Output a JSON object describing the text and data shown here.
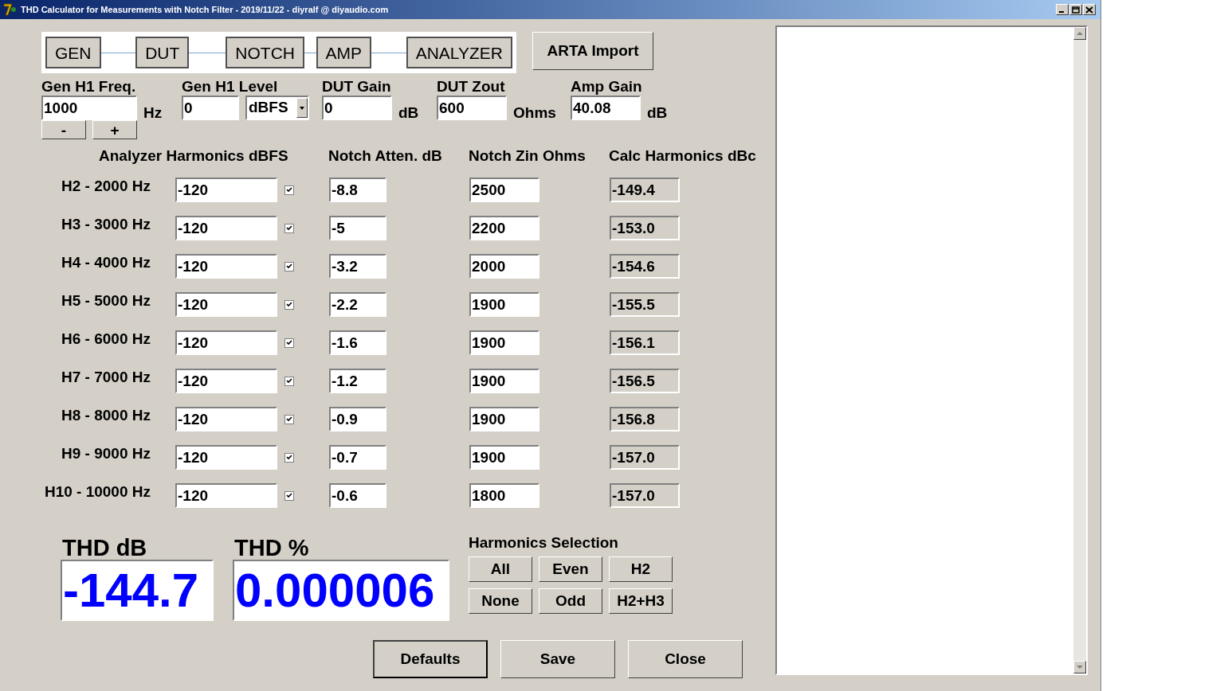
{
  "window": {
    "title": "THD Calculator for Measurements with Notch Filter - 2019/11/22 - diyralf @ diyaudio.com"
  },
  "chain": [
    "GEN",
    "DUT",
    "NOTCH",
    "AMP",
    "ANALYZER"
  ],
  "arta_button": "ARTA Import",
  "params": {
    "gen_freq": {
      "label": "Gen H1 Freq.",
      "value": "1000",
      "unit": "Hz"
    },
    "step_buttons": [
      "-",
      "+"
    ],
    "gen_level": {
      "label": "Gen H1 Level",
      "value": "0",
      "unit": "dBFS"
    },
    "dut_gain": {
      "label": "DUT Gain",
      "value": "0",
      "unit": "dB"
    },
    "dut_zout": {
      "label": "DUT Zout",
      "value": "600",
      "unit": "Ohms"
    },
    "amp_gain": {
      "label": "Amp Gain",
      "value": "40.08",
      "unit": "dB"
    }
  },
  "table": {
    "columns": [
      "Analyzer Harmonics dBFS",
      "Notch Atten. dB",
      "Notch Zin Ohms",
      "Calc Harmonics dBc"
    ],
    "rows": [
      {
        "label": "H2 - 2000 Hz",
        "analyzer": "-120",
        "checked": true,
        "atten": "-8.8",
        "zin": "2500",
        "calc": "-149.4"
      },
      {
        "label": "H3 - 3000 Hz",
        "analyzer": "-120",
        "checked": true,
        "atten": "-5",
        "zin": "2200",
        "calc": "-153.0"
      },
      {
        "label": "H4 - 4000 Hz",
        "analyzer": "-120",
        "checked": true,
        "atten": "-3.2",
        "zin": "2000",
        "calc": "-154.6"
      },
      {
        "label": "H5 - 5000 Hz",
        "analyzer": "-120",
        "checked": true,
        "atten": "-2.2",
        "zin": "1900",
        "calc": "-155.5"
      },
      {
        "label": "H6 - 6000 Hz",
        "analyzer": "-120",
        "checked": true,
        "atten": "-1.6",
        "zin": "1900",
        "calc": "-156.1"
      },
      {
        "label": "H7 - 7000 Hz",
        "analyzer": "-120",
        "checked": true,
        "atten": "-1.2",
        "zin": "1900",
        "calc": "-156.5"
      },
      {
        "label": "H8 - 8000 Hz",
        "analyzer": "-120",
        "checked": true,
        "atten": "-0.9",
        "zin": "1900",
        "calc": "-156.8"
      },
      {
        "label": "H9 - 9000 Hz",
        "analyzer": "-120",
        "checked": true,
        "atten": "-0.7",
        "zin": "1900",
        "calc": "-157.0"
      },
      {
        "label": "H10 - 10000 Hz",
        "analyzer": "-120",
        "checked": true,
        "atten": "-0.6",
        "zin": "1800",
        "calc": "-157.0"
      }
    ]
  },
  "thd_db": {
    "label": "THD dB",
    "value": "-144.7"
  },
  "thd_percent": {
    "label": "THD %",
    "value": "0.000006"
  },
  "harmonics_selection": {
    "title": "Harmonics Selection",
    "buttons": [
      "All",
      "Even",
      "H2",
      "None",
      "Odd",
      "H2+H3"
    ]
  },
  "bottom_buttons": [
    {
      "label": "Defaults",
      "focused": true
    },
    {
      "label": "Save",
      "focused": false
    },
    {
      "label": "Close",
      "focused": false
    }
  ]
}
